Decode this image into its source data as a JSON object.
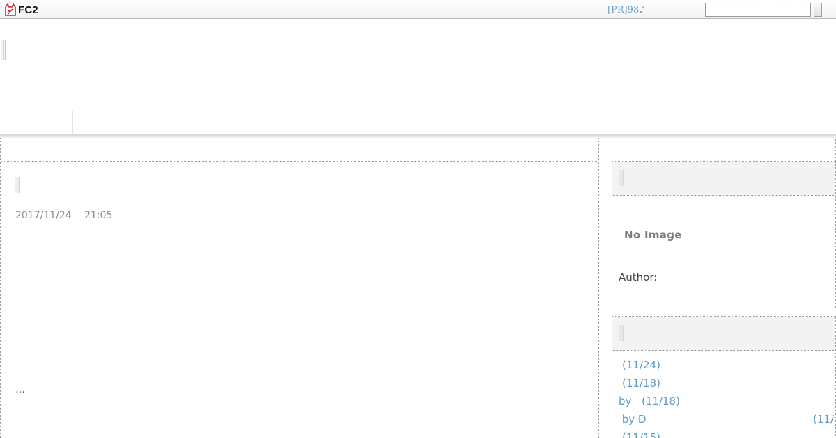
{
  "topbar": {
    "logo_text": "FC2",
    "pr_link": "[PR]98♪",
    "search_input_value": "",
    "search_button_label": ""
  },
  "entry": {
    "date": "2017/11/24　 21:05",
    "read_more": "…"
  },
  "sidebar": {
    "profile": {
      "no_image": "No Image",
      "author_label": "Author:"
    },
    "comments": [
      {
        "text": " ",
        "date": "(11/24)"
      },
      {
        "text": " ",
        "date": "(11/18)"
      },
      {
        "text": "by ",
        "date": "(11/18)"
      },
      {
        "text": " by D",
        "date": "(11/"
      },
      {
        "text": " ",
        "date": "(11/15)"
      }
    ]
  },
  "colors": {
    "link": "#5b9cc8",
    "pr_link": "#6aa0cc",
    "muted_text": "#8c8c8c",
    "sidebar_head_bg": "#f3f3f3"
  }
}
